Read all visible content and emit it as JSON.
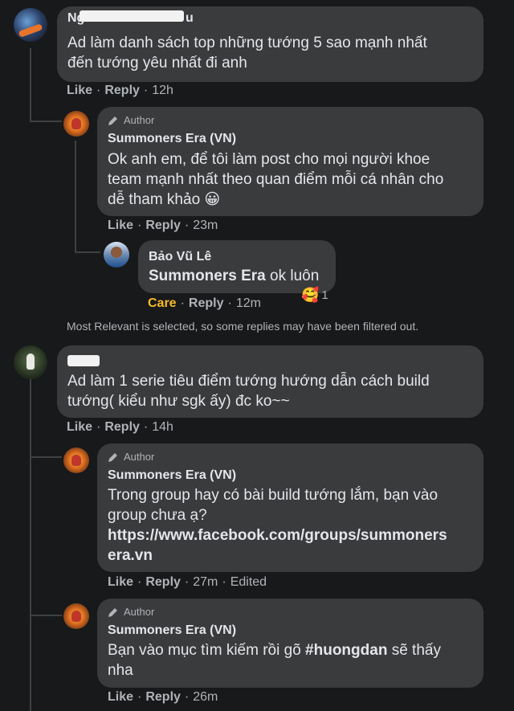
{
  "comments": [
    {
      "author_name_visible": "Ng...Minh...u",
      "text_lines": [
        "Ad làm danh sách top những tướng 5 sao mạnh nhất",
        "đến tướng yêu nhất đi anh"
      ],
      "like": "Like",
      "reply": "Reply",
      "time": "12h"
    },
    {
      "author_badge": "Author",
      "name": "Summoners Era (VN)",
      "text_lines": [
        "Ok anh em, để tôi làm post cho mọi người khoe",
        "team mạnh nhất theo quan điểm mỗi cá nhân cho",
        "dễ tham khảo 😀"
      ],
      "like": "Like",
      "reply": "Reply",
      "time": "23m"
    },
    {
      "name": "Bảo Vũ Lê",
      "mention": "Summoners Era",
      "text_rest": " ok luôn",
      "care": "Care",
      "reply": "Reply",
      "time": "12m",
      "reaction_count": "1"
    },
    {
      "filter_note": "Most Relevant is selected, so some replies may have been filtered out."
    },
    {
      "text_lines": [
        "Ad làm 1 serie tiêu điểm tướng hướng dẫn cách build",
        "tướng( kiểu như sgk ấy) đc ko~~"
      ],
      "like": "Like",
      "reply": "Reply",
      "time": "14h"
    },
    {
      "author_badge": "Author",
      "name": "Summoners Era (VN)",
      "text_lines": [
        "Trong group hay có bài build tướng lắm, bạn vào",
        "group chưa ạ?"
      ],
      "link_lines": [
        "https://www.facebook.com/groups/summoners",
        "era.vn"
      ],
      "like": "Like",
      "reply": "Reply",
      "time": "27m",
      "edited": "Edited"
    },
    {
      "author_badge": "Author",
      "name": "Summoners Era (VN)",
      "text_before": "Bạn vào mục tìm kiếm rồi gõ ",
      "hashtag": "#huongdan",
      "text_after": " sẽ thấy",
      "text_line2": "nha",
      "like": "Like",
      "reply": "Reply",
      "time": "26m"
    }
  ],
  "colors": {
    "background": "#18191a",
    "bubble": "#3a3b3c",
    "text": "#e4e6eb",
    "secondary": "#b0b3b8",
    "care": "#f7b928"
  }
}
